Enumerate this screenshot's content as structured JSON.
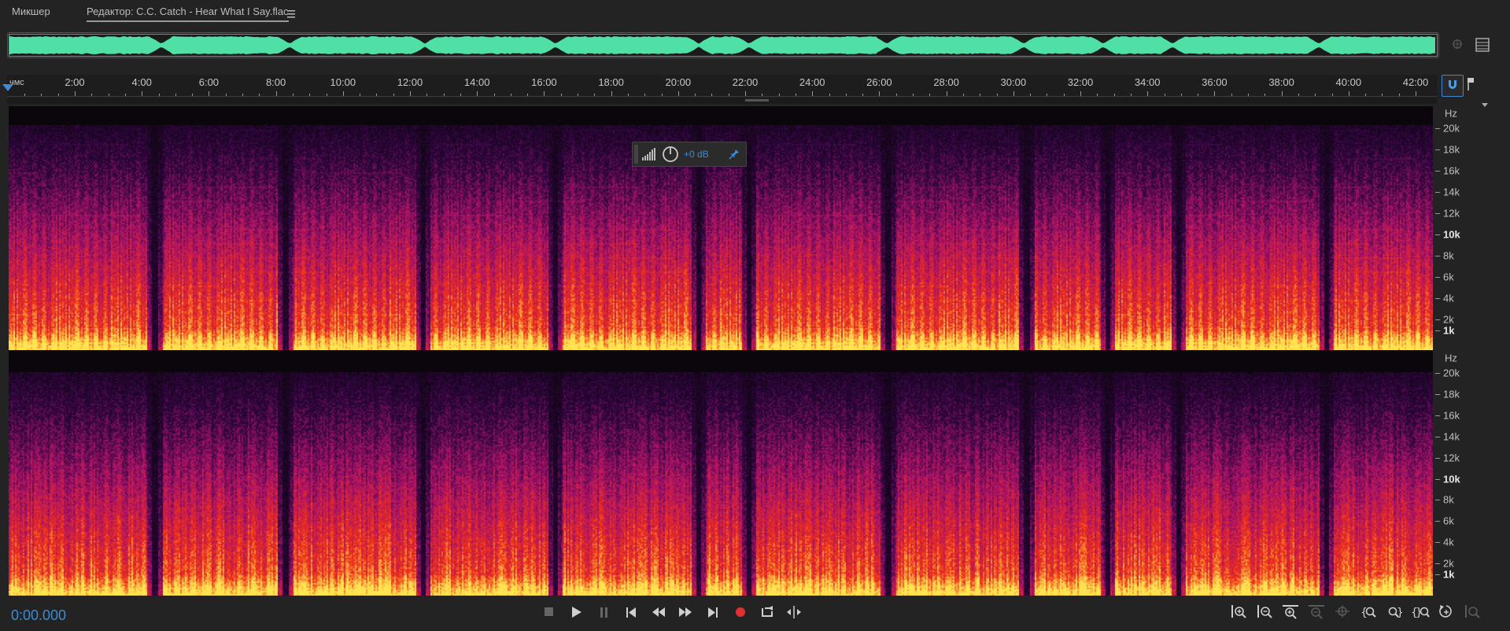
{
  "tabs": {
    "mixer": "Микшер",
    "editor": "Редактор: C.C. Catch - Hear What I Say.flac",
    "menu_icon": "hamburger-menu-icon"
  },
  "ruler": {
    "unit": "чмс",
    "labels": [
      "2:00",
      "4:00",
      "6:00",
      "8:00",
      "10:00",
      "12:00",
      "14:00",
      "16:00",
      "18:00",
      "20:00",
      "22:00",
      "24:00",
      "26:00",
      "28:00",
      "30:00",
      "32:00",
      "34:00",
      "36:00",
      "38:00",
      "40:00",
      "42:00"
    ]
  },
  "spectrogram": {
    "unit": "Hz",
    "freq_labels": [
      "20k",
      "18k",
      "16k",
      "14k",
      "12k",
      "10k",
      "8k",
      "6k",
      "4k",
      "2k",
      "1k"
    ],
    "bold_labels": [
      "10k",
      "1k"
    ],
    "colors": {
      "low": "#130515",
      "mid": "#7a1a6e",
      "hot": "#e0301c",
      "peak": "#ffd84a"
    }
  },
  "hud": {
    "level": "+0 dB"
  },
  "transport": {
    "time": "0:00.000",
    "buttons": [
      "stop-icon",
      "play-icon",
      "pause-icon",
      "go-to-start-icon",
      "rewind-icon",
      "fast-forward-icon",
      "go-to-end-icon",
      "record-icon",
      "loop-icon",
      "skip-selection-icon"
    ]
  },
  "zoom": {
    "buttons": [
      "zoom-in-amplitude-icon",
      "zoom-out-amplitude-icon",
      "zoom-in-time-icon",
      "zoom-out-time-icon",
      "zoom-to-selection-icon",
      "zoom-in-left-icon",
      "zoom-in-right-icon",
      "zoom-out-full-icon",
      "zoom-in-point-icon",
      "zoom-out-point-icon"
    ]
  },
  "colors": {
    "accent": "#3d8bd4",
    "waveform": "#4fe0a5",
    "record": "#e03030"
  }
}
